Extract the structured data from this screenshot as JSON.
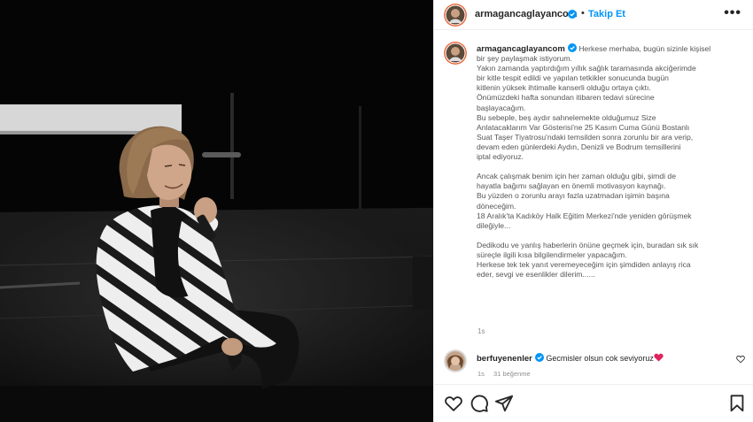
{
  "post": {
    "author": "armagancaglayancom",
    "follow_label": "Takip Et",
    "dot": "•",
    "more_label": "•••",
    "photo_alt": "Armağan Çağlayan sahnede mikrofonla oturuyor",
    "icons": {
      "avatar": "avatar-icon",
      "verified": "verified-badge-icon",
      "more": "more-options-icon",
      "like": "heart-icon",
      "comment": "comment-icon",
      "share": "share-icon",
      "save": "bookmark-icon"
    },
    "colors": {
      "verified": "#0095f6",
      "follow": "#0095f6",
      "heart": "#e0245e"
    }
  },
  "caption": {
    "author": "armagancaglayancom",
    "lines": [
      "Herkese merhaba, bugün sizinle kişisel",
      "bir şey paylaşmak istiyorum.",
      "Yakın zamanda yaptırdığım yıllık sağlık taramasında akciğerimde",
      "bir kitle tespit edildi ve yapılan tetkikler sonucunda bugün",
      "kitlenin yüksek ihtimalle kanserli olduğu ortaya çıktı.",
      "Önümüzdeki hafta sonundan itibaren tedavi sürecine",
      "başlayacağım.",
      "Bu sebeple, beş aydır sahnelemekte olduğumuz Size",
      "Anlatacaklarım Var Gösterisi'ne 25 Kasım Cuma Günü Bostanlı",
      "Suat Taşer Tiyatrosu'ndaki temsilden sonra zorunlu bir ara verip,",
      "devam eden günlerdeki Aydın, Denizli ve Bodrum temsillerini",
      "iptal ediyoruz.",
      "",
      "Ancak çalışmak benim için her zaman olduğu gibi, şimdi de",
      "hayatla bağımı sağlayan en önemli motivasyon kaynağı.",
      "Bu yüzden o zorunlu arayı fazla uzatmadan işimin başına",
      "döneceğim.",
      "18 Aralık'ta Kadıköy Halk Eğitim Merkezi'nde yeniden görüşmek",
      "dileğiyle...",
      "",
      "Dedikodu ve yanlış haberlerin önüne geçmek için, buradan sık sık",
      "süreçle ilgili kısa bilgilendirmeler yapacağım.",
      "Herkese tek tek yanıt veremeyeceğim için şimdiden anlayış rica",
      "eder, sevgi ve esenlikler dilerim......"
    ],
    "time": "1s"
  },
  "comment": {
    "author": "berfuyenenler",
    "text": "Gecmisler olsun cok seviyoruz",
    "time": "1s",
    "likes": "31 beğenme"
  }
}
